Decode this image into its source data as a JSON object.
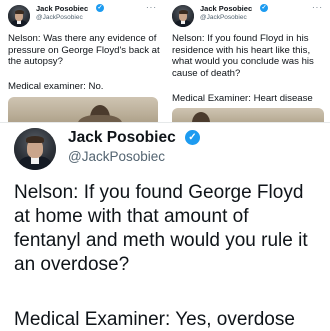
{
  "tweets_top": [
    {
      "name": "Jack Posobiec",
      "handle": "@JackPosobiec",
      "more_icon": "more-icon",
      "text": "Nelson: Was there any evidence of pressure on George Floyd's back at the autopsy?",
      "answer": "Medical examiner: No."
    },
    {
      "name": "Jack Posobiec",
      "handle": "@JackPosobiec",
      "more_icon": "more-icon",
      "text": "Nelson: If you found Floyd in his residence with his heart like this, what would you conclude was his cause of death?",
      "answer": "Medical Examiner: Heart disease"
    }
  ],
  "tweet_main": {
    "name": "Jack Posobiec",
    "handle": "@JackPosobiec",
    "text": "Nelson: If you found George Floyd at home with that amount of fentanyl and meth would you rule it an overdose?",
    "answer": "Medical Examiner: Yes, overdose"
  },
  "colors": {
    "verified": "#1d9bf0",
    "text": "#0f1419",
    "muted": "#536471"
  }
}
